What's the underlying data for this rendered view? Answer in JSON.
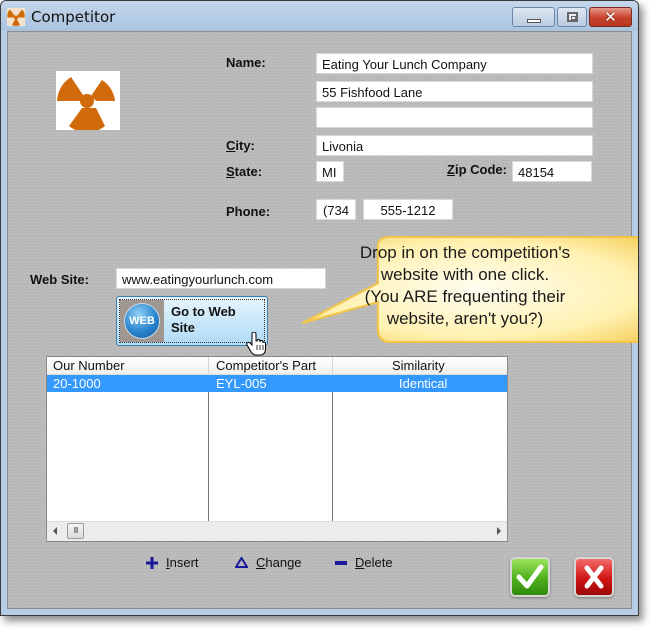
{
  "window": {
    "title": "Competitor",
    "controls": {
      "minimize": "minimize",
      "maximize": "maximize",
      "close": "close"
    }
  },
  "form": {
    "name_label": "Name:",
    "name": "Eating Your Lunch Company",
    "address1": "55 Fishfood Lane",
    "address2": "",
    "city_label_prefix": "C",
    "city_label_rest": "ity:",
    "city": "Livonia",
    "state_label_prefix": "S",
    "state_label_rest": "tate:",
    "state": "MI",
    "zip_label_prefix": "Z",
    "zip_label_rest": "ip Code:",
    "zip": "48154",
    "phone_label": "Phone:",
    "phone_area": "(734",
    "phone_number": "555-1212",
    "website_label": "Web Site:",
    "website": "www.eatingyourlunch.com"
  },
  "web_button": {
    "icon_text": "WEB",
    "line1": "Go to Web",
    "line2": "Site"
  },
  "callout": {
    "line1": "Drop in on the competition's",
    "line2": "website with one click.",
    "line3": "(You ARE frequenting their",
    "line4": "website, aren't you?)"
  },
  "grid": {
    "columns": [
      "Our Number",
      "Competitor's Part",
      "Similarity"
    ],
    "rows": [
      {
        "our_number": "20-1000",
        "competitor_part": "EYL-005",
        "similarity": "Identical",
        "selected": true
      }
    ],
    "scroll_thumb": "III"
  },
  "actions": {
    "insert_prefix": "I",
    "insert_rest": "nsert",
    "change_prefix": "C",
    "change_rest": "hange",
    "delete_prefix": "D",
    "delete_rest": "elete"
  },
  "colors": {
    "selection": "#3399ff",
    "logo_orange": "#d06a0a",
    "callout_fill": "#fff3b8",
    "callout_border": "#f2c54a",
    "ok_green": "#4db01b",
    "cancel_red": "#d11515",
    "action_blue": "#1a1a9a"
  }
}
